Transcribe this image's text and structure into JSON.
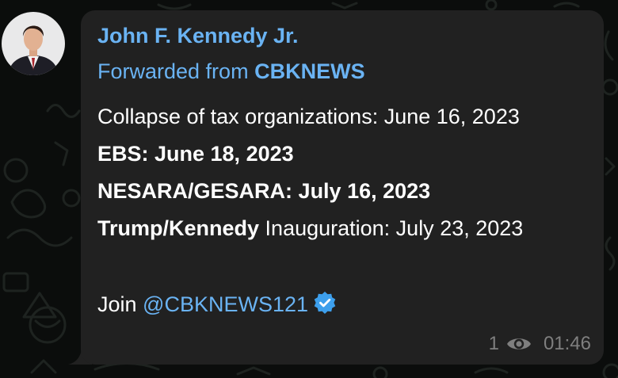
{
  "message": {
    "sender_name": "John F. Kennedy Jr.",
    "forwarded_prefix": "Forwarded from",
    "forwarded_channel": "CBKNEWS",
    "lines": [
      {
        "text": "Collapse of tax organizations: June 16, 2023"
      },
      {
        "bold": "EBS: June 18, 2023"
      },
      {
        "bold": "NESARA/GESARA:",
        "bold_tail": "July 16, 2023"
      },
      {
        "bold": "Trump/Kennedy",
        "text": "Inauguration: July 23, 2023"
      }
    ],
    "join_prefix": "Join",
    "join_mention": "@CBKNEWS121",
    "views": "1",
    "time": "01:46"
  },
  "icons": {
    "avatar": "avatar-photo",
    "verified": "verified-badge-icon",
    "views": "eye-icon"
  },
  "colors": {
    "background": "#0b0d0c",
    "bubble": "#212121",
    "link": "#6ab3f3",
    "text": "#ffffff",
    "meta": "#7f7f7f",
    "verified": "#3d9fec"
  }
}
